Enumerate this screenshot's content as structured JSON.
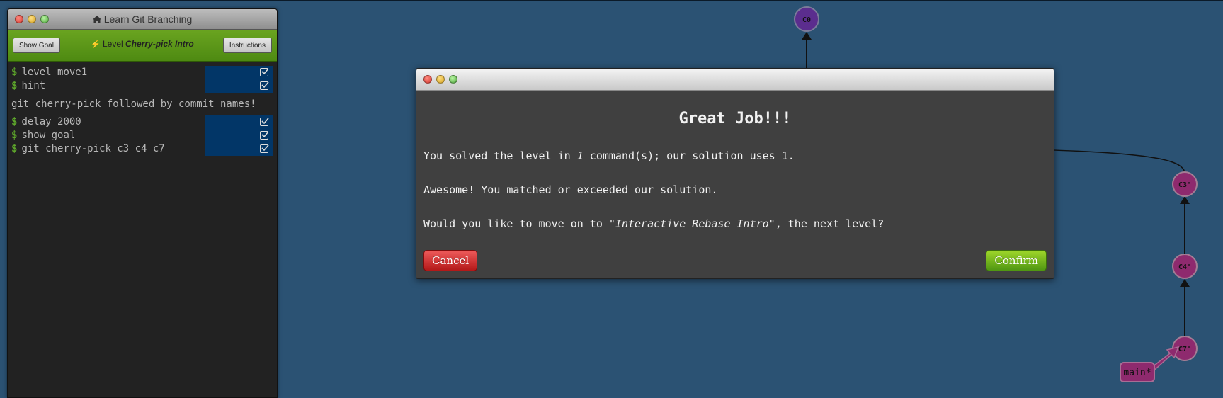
{
  "terminal": {
    "title": "Learn Git Branching",
    "show_goal_label": "Show Goal",
    "instructions_label": "Instructions",
    "level_prefix": "Level",
    "level_name": "Cherry-pick Intro",
    "prompt_symbol": "$",
    "commands_before": [
      {
        "text": "level move1"
      },
      {
        "text": "hint"
      }
    ],
    "hint_text": "git cherry-pick followed by commit names!",
    "commands_after": [
      {
        "text": "delay 2000"
      },
      {
        "text": "show goal"
      },
      {
        "text": "git cherry-pick c3 c4 c7"
      }
    ]
  },
  "graph": {
    "nodes": [
      {
        "id": "C0",
        "color": "#5b2d8e"
      },
      {
        "id": "C3'",
        "color": "#8e2a6e"
      },
      {
        "id": "C4'",
        "color": "#8e2a6e"
      },
      {
        "id": "C7'",
        "color": "#8e2a6e"
      }
    ],
    "branch_label": "main*"
  },
  "modal": {
    "heading": "Great Job!!!",
    "line1_pre": "You solved the level in ",
    "line1_count": "1",
    "line1_post": " command(s); our solution uses 1.",
    "line2": "Awesome! You matched or exceeded our solution.",
    "line3_pre": "Would you like to move on to ",
    "line3_level": "\"Interactive Rebase Intro\"",
    "line3_post": ", the next level?",
    "cancel_label": "Cancel",
    "confirm_label": "Confirm"
  }
}
